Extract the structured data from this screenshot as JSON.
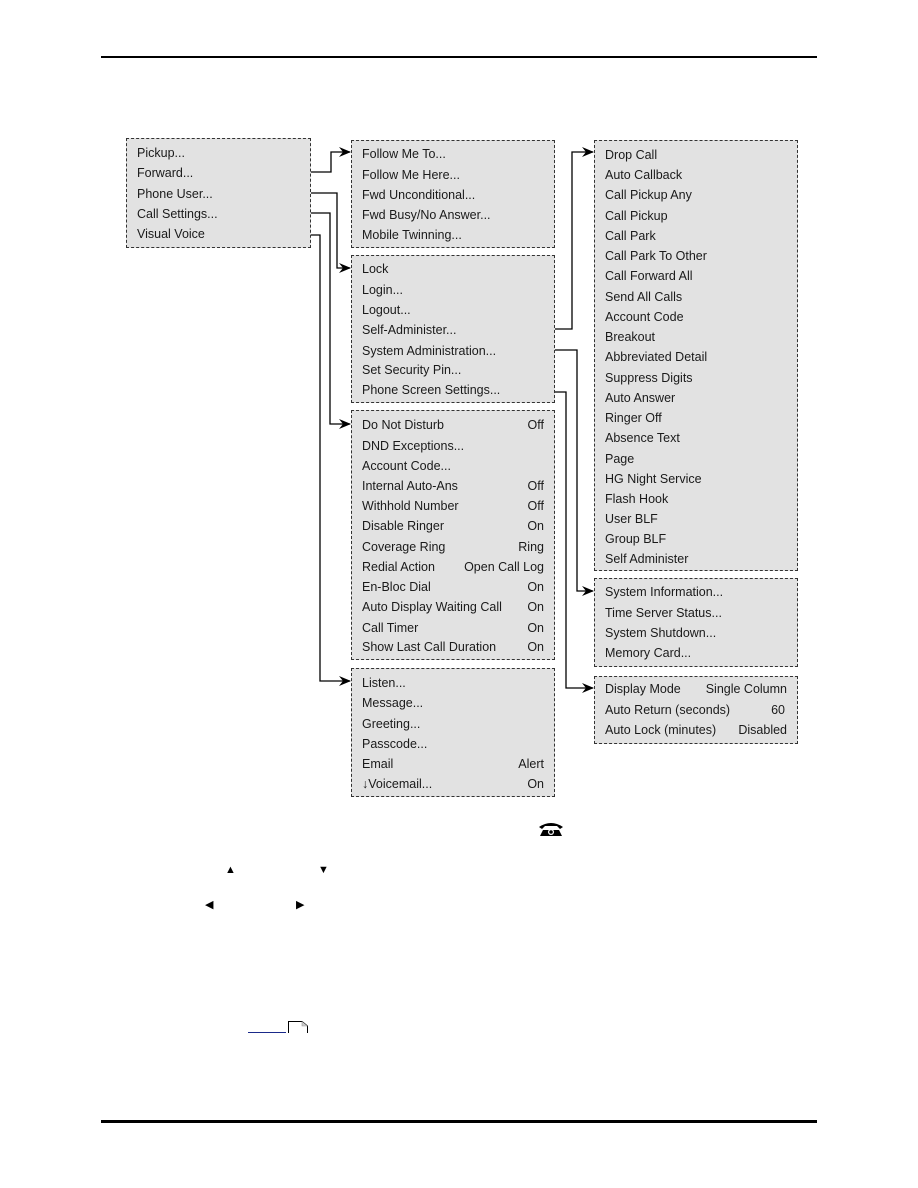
{
  "diagram": {
    "main_menu": {
      "items": [
        {
          "label": "Pickup..."
        },
        {
          "label": "Forward..."
        },
        {
          "label": "Phone User..."
        },
        {
          "label": "Call Settings..."
        },
        {
          "label": "Visual Voice"
        }
      ]
    },
    "forward_menu": {
      "items": [
        {
          "label": "Follow Me To..."
        },
        {
          "label": "Follow Me Here..."
        },
        {
          "label": "Fwd Unconditional..."
        },
        {
          "label": "Fwd Busy/No Answer..."
        },
        {
          "label": "Mobile Twinning..."
        }
      ]
    },
    "phone_user_menu": {
      "items": [
        {
          "label": "Lock"
        },
        {
          "label": "Login..."
        },
        {
          "label": "Logout..."
        },
        {
          "label": "Self-Administer..."
        },
        {
          "label": "System Administration..."
        },
        {
          "label": "Set Security Pin..."
        },
        {
          "label": "Phone Screen Settings..."
        }
      ]
    },
    "call_settings_menu": {
      "items": [
        {
          "label": "Do Not Disturb",
          "value": "Off"
        },
        {
          "label": "DND Exceptions...",
          "value": ""
        },
        {
          "label": "Account Code...",
          "value": ""
        },
        {
          "label": "Internal Auto-Ans",
          "value": "Off"
        },
        {
          "label": "Withhold Number",
          "value": "Off"
        },
        {
          "label": "Disable Ringer",
          "value": "On"
        },
        {
          "label": "Coverage Ring",
          "value": "Ring"
        },
        {
          "label": "Redial Action",
          "value": "Open Call Log"
        },
        {
          "label": "En-Bloc Dial",
          "value": "On"
        },
        {
          "label": "Auto Display Waiting Call",
          "value": "On"
        },
        {
          "label": "Call Timer",
          "value": "On"
        },
        {
          "label": "Show Last Call Duration",
          "value": "On"
        }
      ]
    },
    "visual_voice_menu": {
      "items": [
        {
          "label": "Listen...",
          "value": ""
        },
        {
          "label": "Message...",
          "value": ""
        },
        {
          "label": "Greeting...",
          "value": ""
        },
        {
          "label": "Passcode...",
          "value": ""
        },
        {
          "label": "Email",
          "value": "Alert"
        },
        {
          "label": "↓Voicemail...",
          "value": "On"
        }
      ]
    },
    "self_administer_menu": {
      "items": [
        {
          "label": "Drop Call"
        },
        {
          "label": "Auto Callback"
        },
        {
          "label": "Call Pickup Any"
        },
        {
          "label": "Call Pickup"
        },
        {
          "label": "Call Park"
        },
        {
          "label": "Call Park To Other"
        },
        {
          "label": "Call Forward All"
        },
        {
          "label": "Send All Calls"
        },
        {
          "label": "Account Code"
        },
        {
          "label": "Breakout"
        },
        {
          "label": "Abbreviated Detail"
        },
        {
          "label": "Suppress Digits"
        },
        {
          "label": "Auto Answer"
        },
        {
          "label": "Ringer Off"
        },
        {
          "label": "Absence Text"
        },
        {
          "label": "Page"
        },
        {
          "label": "HG Night Service"
        },
        {
          "label": "Flash Hook"
        },
        {
          "label": "User BLF"
        },
        {
          "label": "Group BLF"
        },
        {
          "label": "Self Administer"
        }
      ]
    },
    "system_admin_menu": {
      "items": [
        {
          "label": "System Information..."
        },
        {
          "label": "Time Server Status..."
        },
        {
          "label": "System Shutdown..."
        },
        {
          "label": "Memory Card..."
        }
      ]
    },
    "phone_screen_menu": {
      "items": [
        {
          "label": "Display Mode",
          "value": "Single Column"
        },
        {
          "label": "Auto Return (seconds)",
          "value": "60"
        },
        {
          "label": "Auto Lock (minutes)",
          "value": "Disabled"
        }
      ]
    }
  },
  "icons": {
    "phone": "phone-icon",
    "up": "▲",
    "down": "▼",
    "left": "◀",
    "right": "▶"
  }
}
